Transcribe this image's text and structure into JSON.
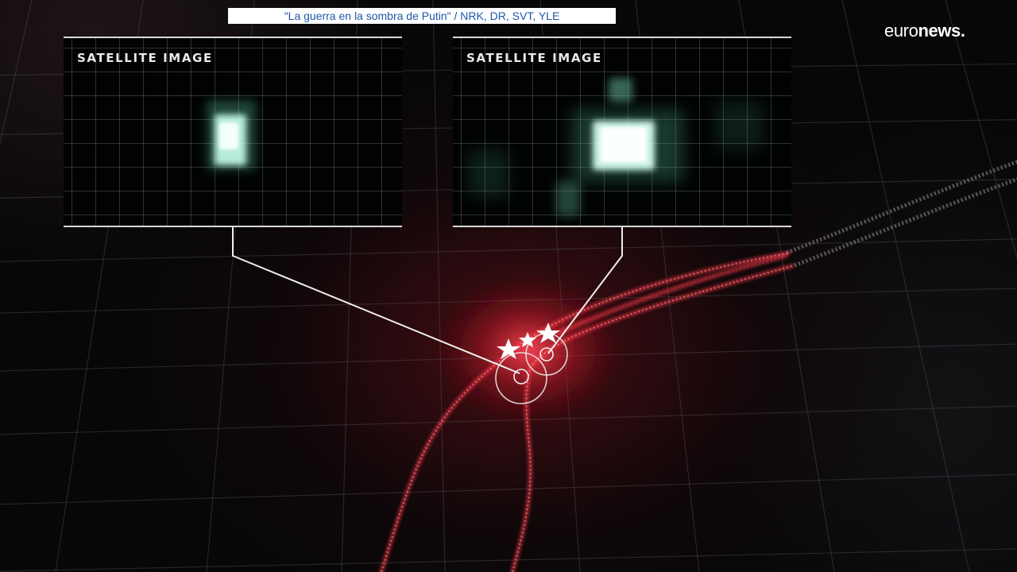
{
  "caption": {
    "text": "\"La guerra en la sombra de Putin\" / NRK, DR, SVT, YLE"
  },
  "logo": {
    "part1": "euro",
    "part2": "news."
  },
  "panels": [
    {
      "title": "SATELLITE IMAGE"
    },
    {
      "title": "SATELLITE IMAGE"
    }
  ],
  "colors": {
    "track_red": "#ff3a4a",
    "track_grey": "#8a8a8e",
    "caption_text": "#1c58a8",
    "satellite_glow": "#7fe0c8",
    "marker_white": "#ffffff"
  },
  "icons": {
    "markers": "star-icon",
    "targets": "target-circle-icon"
  }
}
